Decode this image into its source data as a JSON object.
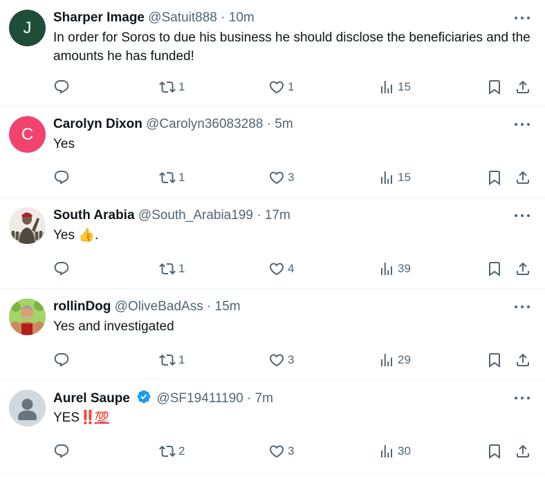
{
  "tweets": [
    {
      "name": "Sharper Image",
      "handle": "@Satuit888",
      "time": "10m",
      "avatar_letter": "J",
      "avatar_color": "#1e4d3a",
      "text": "In order for Soros to due his business he should disclose the beneficiaries and the amounts he has funded!",
      "retweets": "1",
      "likes": "1",
      "views": "15"
    },
    {
      "name": "Carolyn Dixon",
      "handle": "@Carolyn36083288",
      "time": "5m",
      "avatar_letter": "C",
      "avatar_color": "#f2436f",
      "text": "Yes",
      "retweets": "1",
      "likes": "3",
      "views": "15"
    },
    {
      "name": "South Arabia",
      "handle": "@South_Arabia199",
      "time": "17m",
      "avatar_icon": "soldier-salute-photo",
      "text": "Yes",
      "text_emoji": "👍",
      "text_suffix": ".",
      "retweets": "1",
      "likes": "4",
      "views": "39"
    },
    {
      "name": "rollinDog",
      "handle": "@OliveBadAss",
      "time": "15m",
      "avatar_icon": "muscular-man-cartoon",
      "text": "Yes and investigated",
      "retweets": "1",
      "likes": "3",
      "views": "29"
    },
    {
      "name": "Aurel Saupe",
      "handle": "@SF19411190",
      "time": "7m",
      "verified": true,
      "avatar_icon": "default-profile",
      "text": "YES",
      "text_emoji_1": "‼️",
      "text_emoji_2": "💯",
      "retweets": "2",
      "likes": "3",
      "views": "30"
    }
  ],
  "separator": "·",
  "colors": {
    "text_primary": "#0f1419",
    "text_secondary": "#536471",
    "verified_blue": "#1d9bf0",
    "divider": "#eff3f4"
  },
  "icons": [
    "reply-icon",
    "retweet-icon",
    "like-icon",
    "views-icon",
    "bookmark-icon",
    "share-icon",
    "more-icon",
    "verified-badge-icon"
  ]
}
